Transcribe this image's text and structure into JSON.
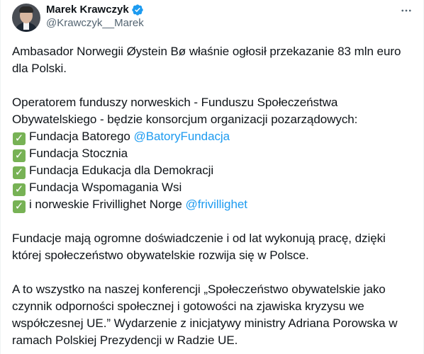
{
  "author": {
    "display_name": "Marek Krawczyk",
    "handle": "@Krawczyk__Marek",
    "verified_icon": "verified-badge-icon",
    "avatar": "profile-photo"
  },
  "more_icon": "more-horizontal-icon",
  "tweet": {
    "para1": "Ambasador Norwegii Øystein Bø właśnie ogłosił przekazanie 83 mln euro dla Polski.",
    "para2": "Operatorem funduszy norweskich - Funduszu Społeczeństwa Obywatelskiego - będzie konsorcjum organizacji pozarządowych:",
    "list": [
      {
        "text": "Fundacja Batorego ",
        "mention": "@BatoryFundacja"
      },
      {
        "text": "Fundacja Stocznia",
        "mention": ""
      },
      {
        "text": "Fundacja Edukacja dla Demokracji",
        "mention": ""
      },
      {
        "text": "Fundacja Wspomagania Wsi",
        "mention": ""
      },
      {
        "text": "i norweskie Frivillighet Norge ",
        "mention": "@frivillighet"
      }
    ],
    "check_symbol": "✓",
    "para3": "Fundacje mają ogromne doświadczenie i od lat wykonują pracę, dzięki której społeczeństwo obywatelskie rozwija się w Polsce.",
    "para4": "A to wszystko na naszej konferencji „Społeczeństwo obywatelskie jako czynnik odporności społecznej i gotowości na zjawiska kryzysu we współczesnej UE.” Wydarzenie z inicjatywy ministry Adriana Porowska w ramach Polskiej Prezydencji w Radzie UE."
  },
  "colors": {
    "link": "#1d9bf0",
    "text": "#0f1419",
    "secondary": "#536471",
    "check": "#77b255"
  }
}
